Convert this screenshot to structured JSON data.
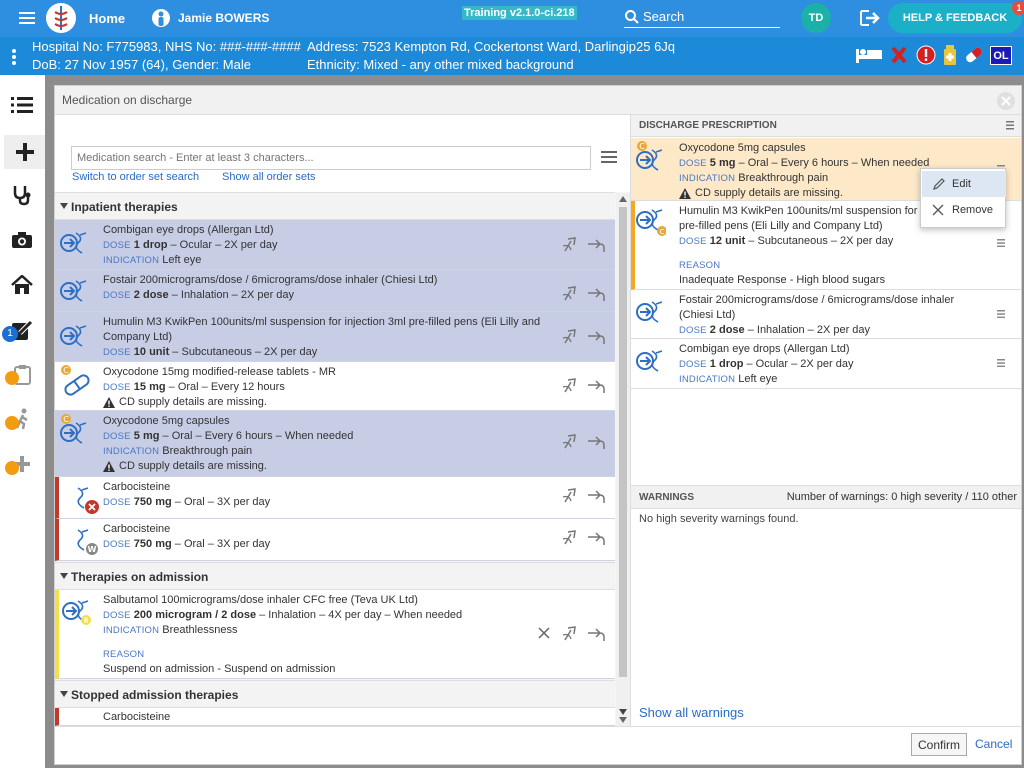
{
  "topbar": {
    "home": "Home",
    "patient_name": "Jamie BOWERS",
    "build": "Training v2.1.0-ci.218",
    "search": "Search",
    "user_initials": "TD",
    "help": "HELP & FEEDBACK",
    "help_badge": "1"
  },
  "patient": {
    "line1": "Hospital No: F775983, NHS No: ###-###-####",
    "line2": "DoB: 27 Nov 1957 (64), Gender: Male",
    "address": "Address: 7523 Kempton Rd, Cockertonst Ward, Darlingip25 6Jq",
    "ethnicity": "Ethnicity: Mixed - any other mixed background",
    "badge_ol": "OL"
  },
  "nav": {
    "badge": "1"
  },
  "modal": {
    "title": "Medication on discharge",
    "search_placeholder": "Medication search - Enter at least 3 characters...",
    "switch_link": "Switch to order set search",
    "show_all_link": "Show all order sets",
    "confirm": "Confirm",
    "cancel": "Cancel"
  },
  "sections": {
    "inpatient": "Inpatient therapies",
    "admission": "Therapies on admission",
    "stopped": "Stopped admission therapies"
  },
  "labels": {
    "dose": "DOSE",
    "indication": "INDICATION",
    "reason": "REASON"
  },
  "inpatient_items": [
    {
      "name": "Combigan eye drops (Allergan Ltd)",
      "dose": "1 drop",
      "route": " – Ocular – 2X per day",
      "indication": "Left eye"
    },
    {
      "name": "Fostair 200micrograms/dose / 6micrograms/dose inhaler (Chiesi Ltd)",
      "dose": "2 dose",
      "route": " – Inhalation – 2X per day"
    },
    {
      "name": "Humulin M3 KwikPen 100units/ml suspension for injection 3ml pre-filled pens (Eli Lilly and",
      "name2": "Company Ltd)",
      "dose": "10 unit",
      "route": " – Subcutaneous – 2X per day"
    },
    {
      "name": "Oxycodone 15mg modified-release tablets - MR",
      "dose": "15 mg",
      "route": " – Oral – Every 12 hours",
      "warning": "CD supply details are missing."
    },
    {
      "name": "Oxycodone 5mg capsules",
      "dose": "5 mg",
      "route": " – Oral – Every 6 hours – When needed",
      "indication": "Breakthrough pain",
      "warning": "CD supply details are missing."
    },
    {
      "name": "Carbocisteine",
      "dose": "750 mg",
      "route": " – Oral – 3X per day"
    },
    {
      "name": "Carbocisteine",
      "dose": "750 mg",
      "route": " – Oral – 3X per day"
    }
  ],
  "admission_items": [
    {
      "name": "Salbutamol 100micrograms/dose inhaler CFC free (Teva UK Ltd)",
      "dose": "200 microgram / 2 dose",
      "route": " – Inhalation – 4X per day – When needed",
      "indication": "Breathlessness",
      "reason": "Suspend on admission - Suspend on admission"
    }
  ],
  "stopped_items": [
    {
      "name": "Carbocisteine"
    }
  ],
  "discharge": {
    "header": "DISCHARGE PRESCRIPTION",
    "items": [
      {
        "name": "Oxycodone 5mg capsules",
        "dose": "5 mg",
        "route": " – Oral – Every 6 hours – When needed",
        "indication": "Breakthrough pain",
        "warning": "CD supply details are missing."
      },
      {
        "name": "Humulin M3 KwikPen 100units/ml suspension for",
        "name2": "pre-filled pens (Eli Lilly and Company Ltd)",
        "dose": "12 unit",
        "route": " – Subcutaneous – 2X per day",
        "reason": "Inadequate Response - High blood sugars"
      },
      {
        "name": "Fostair 200micrograms/dose / 6micrograms/dose inhaler",
        "name2": "(Chiesi Ltd)",
        "dose": "2 dose",
        "route": " – Inhalation – 2X per day"
      },
      {
        "name": "Combigan eye drops (Allergan Ltd)",
        "dose": "1 drop",
        "route": " – Ocular – 2X per day",
        "indication": "Left eye"
      }
    ],
    "context_menu": {
      "edit": "Edit",
      "remove": "Remove"
    }
  },
  "warnings": {
    "header": "WARNINGS",
    "summary": "Number of warnings: 0 high severity / 110 other",
    "none": "No high severity warnings found.",
    "show_all": "Show all warnings"
  },
  "colors": {
    "topbar": "#2e8fe0",
    "patient_bar": "#1c8ad8",
    "selected_row": "#c8cde6",
    "discharge_highlight": "#fde9c8",
    "red_marker": "#c0392b",
    "yellow_marker": "#f2e04a"
  }
}
